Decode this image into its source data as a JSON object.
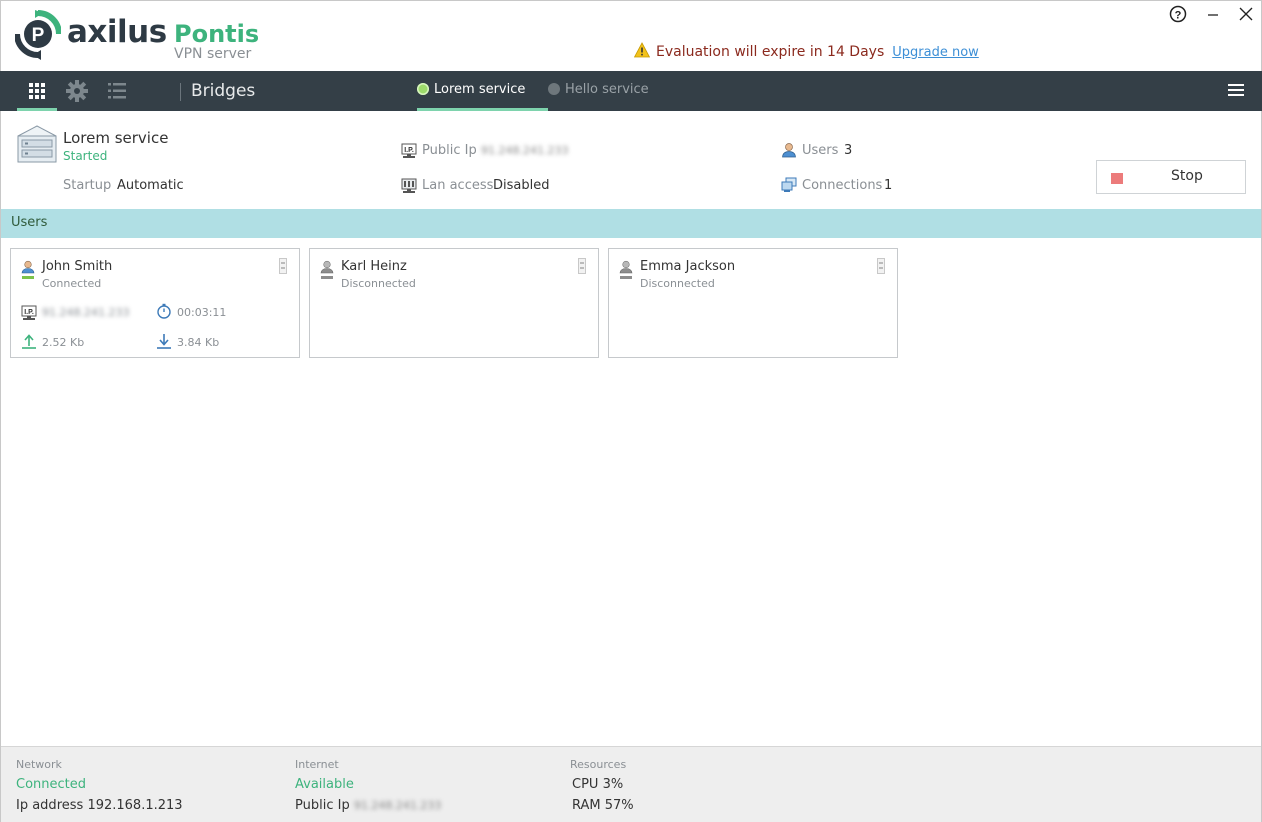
{
  "app": {
    "brand": "axilus",
    "product": "Pontis",
    "subtitle": "VPN server"
  },
  "window_controls": {
    "help": "?",
    "minimize": "−",
    "close": "✕"
  },
  "evaluation": {
    "message": "Evaluation will expire in 14 Days",
    "upgrade_link": "Upgrade now"
  },
  "toolbar": {
    "title": "Bridges",
    "services": [
      {
        "label": "Lorem service",
        "status": "running",
        "active": true
      },
      {
        "label": "Hello service",
        "status": "stopped",
        "active": false
      }
    ]
  },
  "service": {
    "name": "Lorem service",
    "state": "Started",
    "startup_label": "Startup",
    "startup_value": "Automatic",
    "public_ip_label": "Public Ip",
    "public_ip_value": "91.248.241.233",
    "lan_label": "Lan access",
    "lan_value": "Disabled",
    "users_label": "Users",
    "users_value": "3",
    "connections_label": "Connections",
    "connections_value": "1",
    "stop_label": "Stop"
  },
  "users_section": {
    "title": "Users",
    "cards": [
      {
        "name": "John Smith",
        "state": "Connected",
        "ip": "91.248.241.233",
        "duration": "00:03:11",
        "upload": "2.52 Kb",
        "download": "3.84 Kb"
      },
      {
        "name": "Karl Heinz",
        "state": "Disconnected"
      },
      {
        "name": "Emma Jackson",
        "state": "Disconnected"
      }
    ]
  },
  "footer": {
    "network": {
      "header": "Network",
      "status": "Connected",
      "ip_label": "Ip address",
      "ip_value": "192.168.1.213"
    },
    "internet": {
      "header": "Internet",
      "status": "Available",
      "ip_label": "Public Ip",
      "ip_value": "91.248.241.233"
    },
    "resources": {
      "header": "Resources",
      "cpu": "CPU 3%",
      "ram": "RAM 57%"
    }
  },
  "colors": {
    "toolbar_bg": "#343f47",
    "accent_green": "#3db37d",
    "users_bar": "#b0dfe4",
    "warning_text": "#8b2a1e",
    "link": "#3d8fd6",
    "stop_square": "#ec7b7b"
  },
  "icons": [
    "logo-icon",
    "help-icon",
    "minimize-icon",
    "close-icon",
    "warning-icon",
    "grid-icon",
    "gear-icon",
    "list-icon",
    "status-dot-icon",
    "hamburger-icon",
    "server-icon",
    "ip-icon",
    "lan-icon",
    "user-icon",
    "connections-icon",
    "stop-icon",
    "card-menu-icon",
    "timer-icon",
    "upload-icon",
    "download-icon"
  ]
}
